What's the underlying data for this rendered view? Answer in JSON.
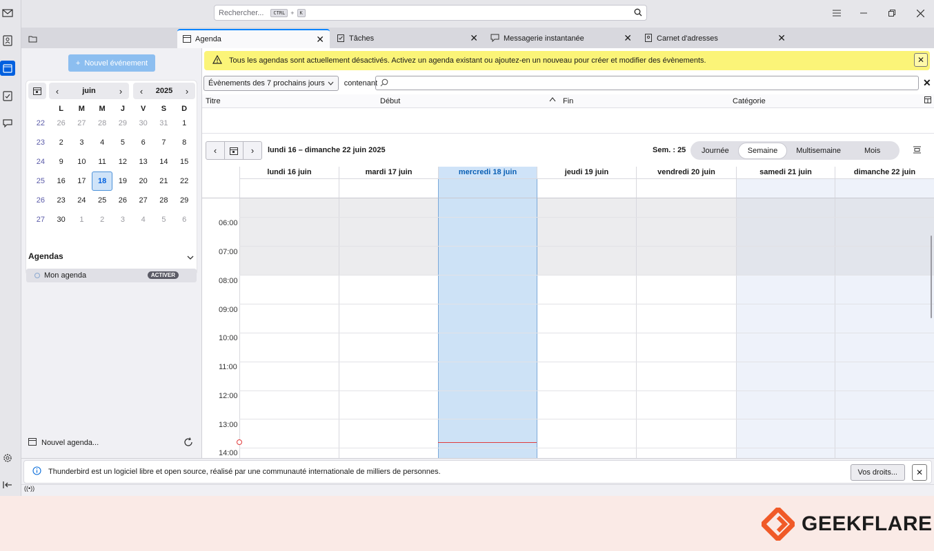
{
  "titlebar": {
    "search_placeholder": "Rechercher...",
    "shortcut_key1": "CTRL",
    "shortcut_plus": "+",
    "shortcut_key2": "K"
  },
  "tabs": [
    {
      "label": "Agenda"
    },
    {
      "label": "Tâches"
    },
    {
      "label": "Messagerie instantanée"
    },
    {
      "label": "Carnet d'adresses"
    }
  ],
  "sidebar": {
    "new_event": "Nouvel événement",
    "month": "juin",
    "year": "2025",
    "weekday_headers": [
      "L",
      "M",
      "M",
      "J",
      "V",
      "S",
      "D"
    ],
    "weeks": [
      {
        "wk": "22",
        "days": [
          "26",
          "27",
          "28",
          "29",
          "30",
          "31",
          "1"
        ]
      },
      {
        "wk": "23",
        "days": [
          "2",
          "3",
          "4",
          "5",
          "6",
          "7",
          "8"
        ]
      },
      {
        "wk": "24",
        "days": [
          "9",
          "10",
          "11",
          "12",
          "13",
          "14",
          "15"
        ]
      },
      {
        "wk": "25",
        "days": [
          "16",
          "17",
          "18",
          "19",
          "20",
          "21",
          "22"
        ]
      },
      {
        "wk": "26",
        "days": [
          "23",
          "24",
          "25",
          "26",
          "27",
          "28",
          "29"
        ]
      },
      {
        "wk": "27",
        "days": [
          "30",
          "1",
          "2",
          "3",
          "4",
          "5",
          "6"
        ]
      }
    ],
    "agendas_title": "Agendas",
    "agenda_name": "Mon agenda",
    "activate": "ACTIVER",
    "new_agenda": "Nouvel agenda..."
  },
  "notification": "Tous les agendas sont actuellement désactivés. Activez un agenda existant ou ajoutez-en un nouveau pour créer et modifier des évènements.",
  "filter": {
    "selected": "Évènements des 7 prochains jours",
    "contains": "contenant"
  },
  "list_columns": [
    "Titre",
    "Début",
    "Fin",
    "Catégorie"
  ],
  "calendar": {
    "range": "lundi 16 – dimanche 22 juin 2025",
    "week": "Sem. : 25",
    "views": [
      "Journée",
      "Semaine",
      "Multisemaine",
      "Mois"
    ],
    "days": [
      "lundi 16 juin",
      "mardi 17 juin",
      "mercredi 18 juin",
      "jeudi 19 juin",
      "vendredi 20 juin",
      "samedi 21 juin",
      "dimanche 22 juin"
    ],
    "hours": [
      "06:00",
      "07:00",
      "08:00",
      "09:00",
      "10:00",
      "11:00",
      "12:00",
      "13:00",
      "14:00"
    ]
  },
  "infobar": {
    "text": "Thunderbird est un logiciel libre et open source, réalisé par une communauté internationale de milliers de personnes.",
    "button": "Vos droits..."
  },
  "brand": "GEEKFLARE"
}
